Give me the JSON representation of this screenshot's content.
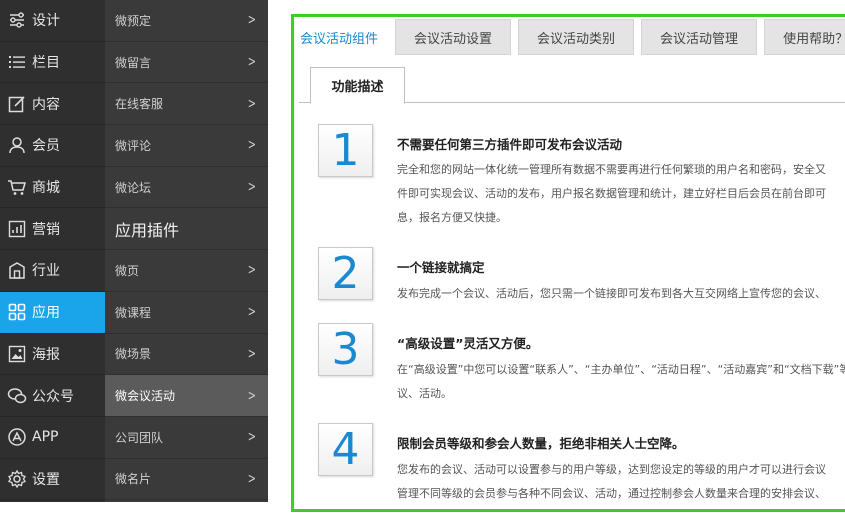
{
  "main_nav": [
    {
      "label": "设计",
      "icon": "design-icon"
    },
    {
      "label": "栏目",
      "icon": "list-icon"
    },
    {
      "label": "内容",
      "icon": "edit-icon"
    },
    {
      "label": "会员",
      "icon": "user-icon"
    },
    {
      "label": "商城",
      "icon": "cart-icon"
    },
    {
      "label": "营销",
      "icon": "chart-icon"
    },
    {
      "label": "行业",
      "icon": "industry-icon"
    },
    {
      "label": "应用",
      "icon": "apps-icon",
      "active": true
    },
    {
      "label": "海报",
      "icon": "poster-icon"
    },
    {
      "label": "公众号",
      "icon": "wechat-icon"
    },
    {
      "label": "APP",
      "icon": "app-store-icon"
    },
    {
      "label": "设置",
      "icon": "gear-icon"
    }
  ],
  "sub_nav": {
    "items_top": [
      "微预定",
      "微留言",
      "在线客服",
      "微评论",
      "微论坛"
    ],
    "section_header": "应用插件",
    "items_bottom": [
      "微页",
      "微课程",
      "微场景",
      "微会议活动",
      "公司团队",
      "微名片"
    ],
    "active_item": "微会议活动"
  },
  "tabs": [
    "会议活动组件",
    "会议活动设置",
    "会议活动类别",
    "会议活动管理",
    "使用帮助？"
  ],
  "subtab": "功能描述",
  "features": [
    {
      "number": "1",
      "title": "不需要任何第三方插件即可发布会议活动",
      "lines": [
        "完全和您的网站一体化统一管理所有数据不需要再进行任何繁琐的用户名和密码，安全又",
        "件即可实现会议、活动的发布，用户报名数据管理和统计，建立好栏目后会员在前台即可",
        "息，报名方便又快捷。"
      ]
    },
    {
      "number": "2",
      "title": "一个链接就搞定",
      "lines": [
        "发布完成一个会议、活动后，您只需一个链接即可发布到各大互交网络上宣传您的会议、"
      ]
    },
    {
      "number": "3",
      "title": "“高级设置”灵活又方便。",
      "lines": [
        "在“高级设置”中您可以设置“联系人”、“主办单位”、“活动日程”、“活动嘉宾”和“文档下载”等",
        "议、活动。"
      ]
    },
    {
      "number": "4",
      "title": "限制会员等级和参会人数量，拒绝非相关人士空降。",
      "lines": [
        "您发布的会议、活动可以设置参与的用户等级，达到您设定的等级的用户才可以进行会议",
        "管理不同等级的会员参与各种不同会议、活动，通过控制参会人数量来合理的安排会议、"
      ]
    }
  ],
  "colors": {
    "accent": "#1aa4ea",
    "panel_border": "#3ecc28",
    "number": "#1a8ad0"
  }
}
